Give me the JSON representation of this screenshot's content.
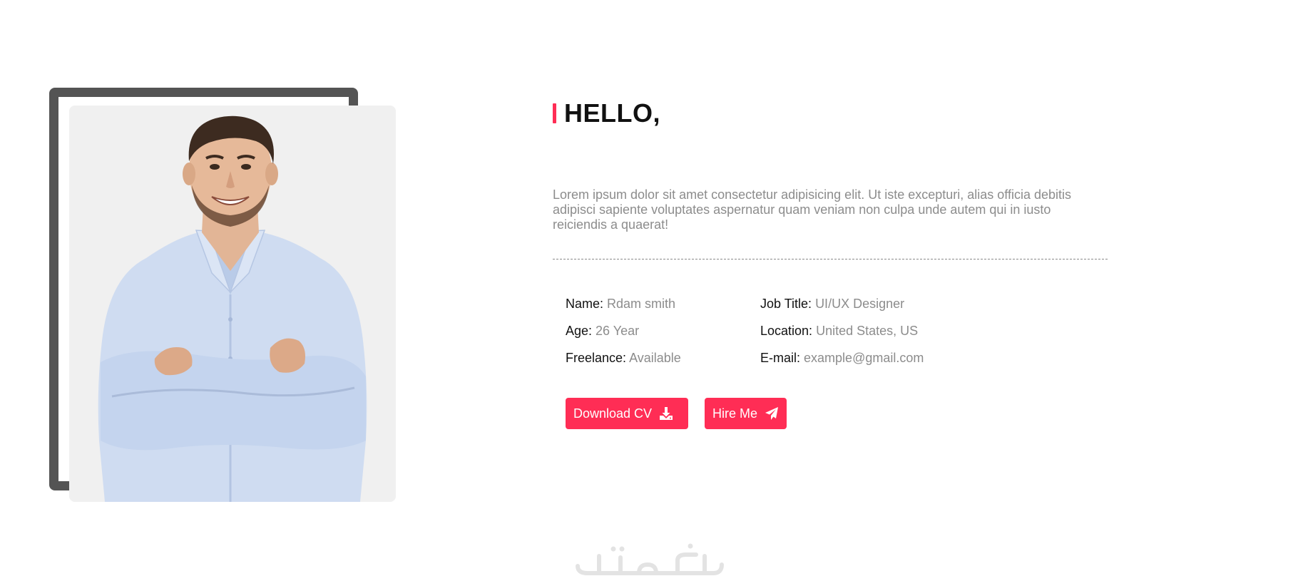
{
  "intro_section": {
    "heading": "HELLO,",
    "description": "Lorem ipsum dolor sit amet consectetur adipisicing elit. Ut iste excepturi, alias officia debitis adipisci sapiente voluptates aspernatur quam veniam non culpa unde autem qui in iusto reiciendis a quaerat!"
  },
  "details": {
    "left": [
      {
        "label": "Name:",
        "value": "Rdam smith"
      },
      {
        "label": "Age:",
        "value": "26 Year"
      },
      {
        "label": "Freelance:",
        "value": "Available"
      }
    ],
    "right": [
      {
        "label": "Job Title:",
        "value": "UI/UX Designer"
      },
      {
        "label": "Location:",
        "value": "United States, US"
      },
      {
        "label": "E-mail:",
        "value": "example@gmail.com"
      }
    ]
  },
  "buttons": {
    "download_cv": {
      "label": "Download CV",
      "icon": "download-icon"
    },
    "hire_me": {
      "label": "Hire Me",
      "icon": "paper-plane-icon"
    }
  },
  "watermark": {
    "text": "خمسات"
  },
  "colors": {
    "accent": "#ff2d55",
    "frame": "#545454",
    "muted_text": "#8c8c8c",
    "heading_text": "#111111",
    "photo_background": "#f0f0f0"
  }
}
